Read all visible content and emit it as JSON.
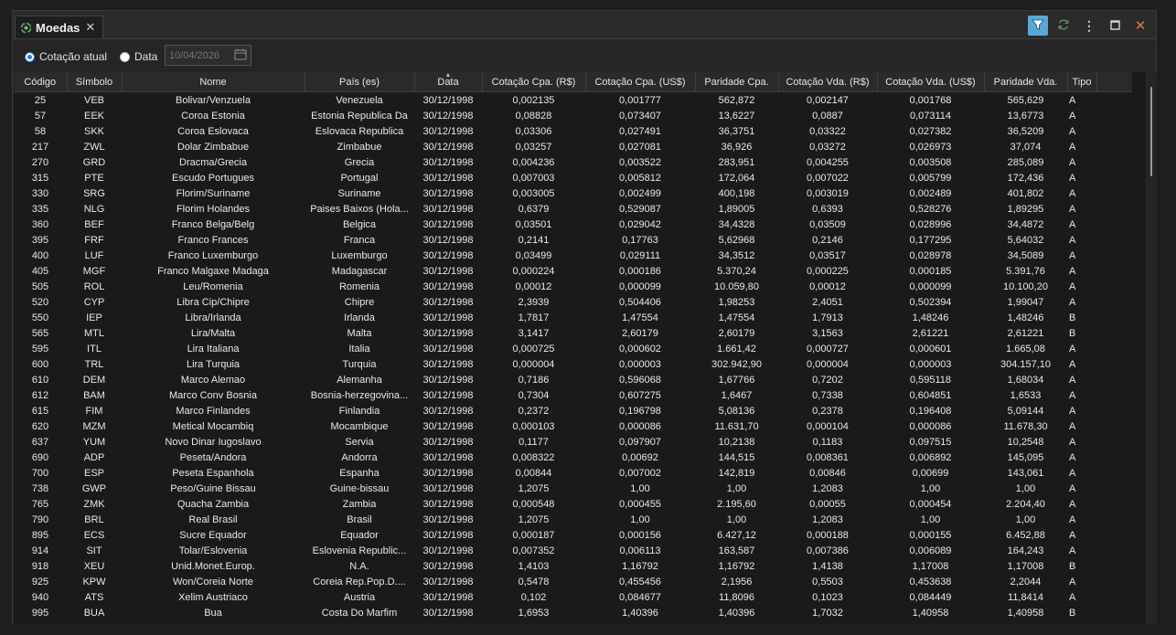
{
  "tab": {
    "title": "Moedas",
    "icon": "currency-refresh-icon",
    "close": "✕"
  },
  "toolbar": {
    "filter_icon": "filter-icon",
    "refresh_icon": "refresh-icon",
    "more_icon": "⋮",
    "maximize_icon": "□",
    "close_icon": "✕",
    "accent_color": "#5aa6d6",
    "close_color": "#e07a3a"
  },
  "options": {
    "radio_current": "Cotação atual",
    "radio_date": "Data",
    "date_value": "10/04/2026"
  },
  "table": {
    "columns": [
      "Código",
      "Símbolo",
      "Nome",
      "País (es)",
      "Data",
      "Cotação Cpa. (R$)",
      "Cotação Cpa. (US$)",
      "Paridade Cpa.",
      "Cotação Vda. (R$)",
      "Cotação Vda. (US$)",
      "Paridade Vda.",
      "Tipo"
    ],
    "rows": [
      [
        "25",
        "VEB",
        "Bolivar/Venzuela",
        "Venezuela",
        "30/12/1998",
        "0,002135",
        "0,001777",
        "562,872",
        "0,002147",
        "0,001768",
        "565,629",
        "A"
      ],
      [
        "57",
        "EEK",
        "Coroa Estonia",
        "Estonia  Republica Da",
        "30/12/1998",
        "0,08828",
        "0,073407",
        "13,6227",
        "0,0887",
        "0,073114",
        "13,6773",
        "A"
      ],
      [
        "58",
        "SKK",
        "Coroa Eslovaca",
        "Eslovaca  Republica",
        "30/12/1998",
        "0,03306",
        "0,027491",
        "36,3751",
        "0,03322",
        "0,027382",
        "36,5209",
        "A"
      ],
      [
        "217",
        "ZWL",
        "Dolar Zimbabue",
        "Zimbabue",
        "30/12/1998",
        "0,03257",
        "0,027081",
        "36,926",
        "0,03272",
        "0,026973",
        "37,074",
        "A"
      ],
      [
        "270",
        "GRD",
        "Dracma/Grecia",
        "Grecia",
        "30/12/1998",
        "0,004236",
        "0,003522",
        "283,951",
        "0,004255",
        "0,003508",
        "285,089",
        "A"
      ],
      [
        "315",
        "PTE",
        "Escudo Portugues",
        "Portugal",
        "30/12/1998",
        "0,007003",
        "0,005812",
        "172,064",
        "0,007022",
        "0,005799",
        "172,436",
        "A"
      ],
      [
        "330",
        "SRG",
        "Florim/Suriname",
        "Suriname",
        "30/12/1998",
        "0,003005",
        "0,002499",
        "400,198",
        "0,003019",
        "0,002489",
        "401,802",
        "A"
      ],
      [
        "335",
        "NLG",
        "Florim Holandes",
        "Paises Baixos (Hola...",
        "30/12/1998",
        "0,6379",
        "0,529087",
        "1,89005",
        "0,6393",
        "0,528276",
        "1,89295",
        "A"
      ],
      [
        "360",
        "BEF",
        "Franco Belga/Belg",
        "Belgica",
        "30/12/1998",
        "0,03501",
        "0,029042",
        "34,4328",
        "0,03509",
        "0,028996",
        "34,4872",
        "A"
      ],
      [
        "395",
        "FRF",
        "Franco Frances",
        "Franca",
        "30/12/1998",
        "0,2141",
        "0,17763",
        "5,62968",
        "0,2146",
        "0,177295",
        "5,64032",
        "A"
      ],
      [
        "400",
        "LUF",
        "Franco Luxemburgo",
        "Luxemburgo",
        "30/12/1998",
        "0,03499",
        "0,029111",
        "34,3512",
        "0,03517",
        "0,028978",
        "34,5089",
        "A"
      ],
      [
        "405",
        "MGF",
        "Franco Malgaxe Madaga",
        "Madagascar",
        "30/12/1998",
        "0,000224",
        "0,000186",
        "5.370,24",
        "0,000225",
        "0,000185",
        "5.391,76",
        "A"
      ],
      [
        "505",
        "ROL",
        "Leu/Romenia",
        "Romenia",
        "30/12/1998",
        "0,00012",
        "0,000099",
        "10.059,80",
        "0,00012",
        "0,000099",
        "10.100,20",
        "A"
      ],
      [
        "520",
        "CYP",
        "Libra Cip/Chipre",
        "Chipre",
        "30/12/1998",
        "2,3939",
        "0,504406",
        "1,98253",
        "2,4051",
        "0,502394",
        "1,99047",
        "A"
      ],
      [
        "550",
        "IEP",
        "Libra/Irlanda",
        "Irlanda",
        "30/12/1998",
        "1,7817",
        "1,47554",
        "1,47554",
        "1,7913",
        "1,48246",
        "1,48246",
        "B"
      ],
      [
        "565",
        "MTL",
        "Lira/Malta",
        "Malta",
        "30/12/1998",
        "3,1417",
        "2,60179",
        "2,60179",
        "3,1563",
        "2,61221",
        "2,61221",
        "B"
      ],
      [
        "595",
        "ITL",
        "Lira Italiana",
        "Italia",
        "30/12/1998",
        "0,000725",
        "0,000602",
        "1.661,42",
        "0,000727",
        "0,000601",
        "1.665,08",
        "A"
      ],
      [
        "600",
        "TRL",
        "Lira Turquia",
        "Turquia",
        "30/12/1998",
        "0,000004",
        "0,000003",
        "302.942,90",
        "0,000004",
        "0,000003",
        "304.157,10",
        "A"
      ],
      [
        "610",
        "DEM",
        "Marco Alemao",
        "Alemanha",
        "30/12/1998",
        "0,7186",
        "0,596068",
        "1,67766",
        "0,7202",
        "0,595118",
        "1,68034",
        "A"
      ],
      [
        "612",
        "BAM",
        "Marco Conv Bosnia",
        "Bosnia-herzegovina...",
        "30/12/1998",
        "0,7304",
        "0,607275",
        "1,6467",
        "0,7338",
        "0,604851",
        "1,6533",
        "A"
      ],
      [
        "615",
        "FIM",
        "Marco Finlandes",
        "Finlandia",
        "30/12/1998",
        "0,2372",
        "0,196798",
        "5,08136",
        "0,2378",
        "0,196408",
        "5,09144",
        "A"
      ],
      [
        "620",
        "MZM",
        "Metical Mocambiq",
        "Mocambique",
        "30/12/1998",
        "0,000103",
        "0,000086",
        "11.631,70",
        "0,000104",
        "0,000086",
        "11.678,30",
        "A"
      ],
      [
        "637",
        "YUM",
        "Novo Dinar Iugoslavo",
        "Servia",
        "30/12/1998",
        "0,1177",
        "0,097907",
        "10,2138",
        "0,1183",
        "0,097515",
        "10,2548",
        "A"
      ],
      [
        "690",
        "ADP",
        "Peseta/Andora",
        "Andorra",
        "30/12/1998",
        "0,008322",
        "0,00692",
        "144,515",
        "0,008361",
        "0,006892",
        "145,095",
        "A"
      ],
      [
        "700",
        "ESP",
        "Peseta Espanhola",
        "Espanha",
        "30/12/1998",
        "0,00844",
        "0,007002",
        "142,819",
        "0,00846",
        "0,00699",
        "143,061",
        "A"
      ],
      [
        "738",
        "GWP",
        "Peso/Guine Bissau",
        "Guine-bissau",
        "30/12/1998",
        "1,2075",
        "1,00",
        "1,00",
        "1,2083",
        "1,00",
        "1,00",
        "A"
      ],
      [
        "765",
        "ZMK",
        "Quacha Zambia",
        "Zambia",
        "30/12/1998",
        "0,000548",
        "0,000455",
        "2.195,60",
        "0,00055",
        "0,000454",
        "2.204,40",
        "A"
      ],
      [
        "790",
        "BRL",
        "Real Brasil",
        "Brasil",
        "30/12/1998",
        "1,2075",
        "1,00",
        "1,00",
        "1,2083",
        "1,00",
        "1,00",
        "A"
      ],
      [
        "895",
        "ECS",
        "Sucre Equador",
        "Equador",
        "30/12/1998",
        "0,000187",
        "0,000156",
        "6.427,12",
        "0,000188",
        "0,000155",
        "6.452,88",
        "A"
      ],
      [
        "914",
        "SIT",
        "Tolar/Eslovenia",
        "Eslovenia  Republic...",
        "30/12/1998",
        "0,007352",
        "0,006113",
        "163,587",
        "0,007386",
        "0,006089",
        "164,243",
        "A"
      ],
      [
        "918",
        "XEU",
        "Unid.Monet.Europ.",
        "N.A.",
        "30/12/1998",
        "1,4103",
        "1,16792",
        "1,16792",
        "1,4138",
        "1,17008",
        "1,17008",
        "B"
      ],
      [
        "925",
        "KPW",
        "Won/Coreia Norte",
        "Coreia  Rep.Pop.D....",
        "30/12/1998",
        "0,5478",
        "0,455456",
        "2,1956",
        "0,5503",
        "0,453638",
        "2,2044",
        "A"
      ],
      [
        "940",
        "ATS",
        "Xelim Austriaco",
        "Austria",
        "30/12/1998",
        "0,102",
        "0,084677",
        "11,8096",
        "0,1023",
        "0,084449",
        "11,8414",
        "A"
      ],
      [
        "995",
        "BUA",
        "Bua",
        "Costa Do Marfim",
        "30/12/1998",
        "1,6953",
        "1,40396",
        "1,40396",
        "1,7032",
        "1,40958",
        "1,40958",
        "B"
      ]
    ]
  }
}
